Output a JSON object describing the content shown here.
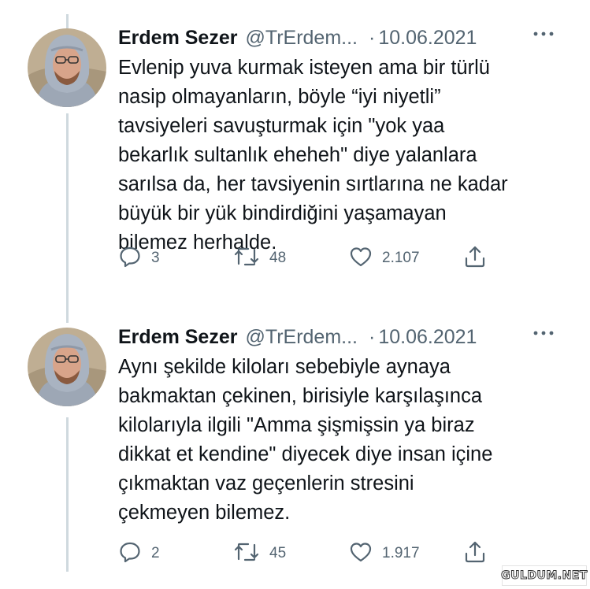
{
  "tweets": [
    {
      "name": "Erdem Sezer",
      "handle": "@TrErdem...",
      "separator": "·",
      "date": "10.06.2021",
      "text_lines": [
        "Evlenip yuva kurmak isteyen ama bir türlü",
        "nasip olmayanların, böyle “iyi niyetli”",
        "tavsiyeleri savuşturmak için \"yok yaa",
        "bekarlık sultanlık eheheh\" diye yalanlara",
        "sarılsa da, her tavsiyenin sırtlarına ne kadar",
        "büyük bir yük bindirdiğini yaşamayan",
        "bilemez herhalde."
      ],
      "replies": "3",
      "retweets": "48",
      "likes": "2.107"
    },
    {
      "name": "Erdem Sezer",
      "handle": "@TrErdem...",
      "separator": "·",
      "date": "10.06.2021",
      "text_lines": [
        "Aynı şekilde kiloları sebebiyle aynaya",
        "bakmaktan çekinen, birisiyle karşılaşınca",
        "kilolarıyla ilgili \"Amma şişmişsin ya biraz",
        "dikkat et kendine\" diyecek diye insan içine",
        "çıkmaktan vaz geçenlerin stresini",
        "çekmeyen bilemez."
      ],
      "replies": "2",
      "retweets": "45",
      "likes": "1.917"
    }
  ],
  "icons": {
    "reply": "reply-icon",
    "retweet": "retweet-icon",
    "like": "like-icon",
    "share": "share-icon",
    "more": "more-icon"
  },
  "colors": {
    "text": "#0f1419",
    "secondary": "#536471",
    "thread_line": "#cfd9de"
  },
  "watermark": "GULDUM.NET"
}
